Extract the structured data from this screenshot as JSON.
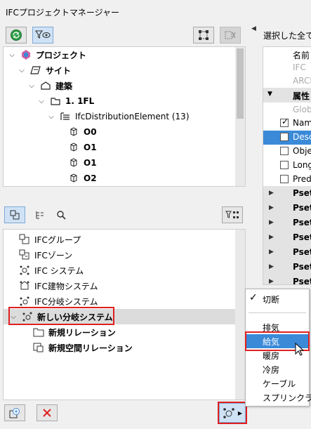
{
  "window": {
    "title": "IFCプロジェクトマネージャー"
  },
  "tree": {
    "items": [
      {
        "label": "プロジェクト"
      },
      {
        "label": "サイト"
      },
      {
        "label": "建築"
      },
      {
        "label": "1. 1FL"
      },
      {
        "label": "IfcDistributionElement (13)"
      },
      {
        "label": "O0"
      },
      {
        "label": "O1"
      },
      {
        "label": "O1"
      },
      {
        "label": "O2"
      }
    ]
  },
  "groups": {
    "items": [
      {
        "label": "IFCグループ"
      },
      {
        "label": "IFCゾーン"
      },
      {
        "label": "IFC システム"
      },
      {
        "label": "IFC建物システム"
      },
      {
        "label": "IFC分岐システム"
      },
      {
        "label": "新しい分岐システム"
      },
      {
        "label": "新規リレーション"
      },
      {
        "label": "新規空間リレーション"
      }
    ]
  },
  "right_panel": {
    "header": "選択した全て:",
    "name_col": "名前",
    "rows": [
      "IFC",
      "ARCH"
    ],
    "attr_label": "属性",
    "glob": "Glob",
    "checks": [
      {
        "label": "Nam",
        "checked": true
      },
      {
        "label": "Desc",
        "checked": false
      },
      {
        "label": "Obje",
        "checked": false
      },
      {
        "label": "Long",
        "checked": false
      },
      {
        "label": "Pred",
        "checked": false
      }
    ],
    "psets": [
      "Pset",
      "Pset",
      "Pset",
      "Pset",
      "Pset",
      "Pset",
      "Pset"
    ]
  },
  "context_menu": {
    "toggle": "切断",
    "items": [
      "排気",
      "給気",
      "暖房",
      "冷房",
      "ケーブル",
      "スプリンクラー"
    ],
    "selected": "給気"
  },
  "colors": {
    "accent": "#3b8ad8",
    "highlight": "#e02020",
    "selection": "#cfe2f5"
  }
}
